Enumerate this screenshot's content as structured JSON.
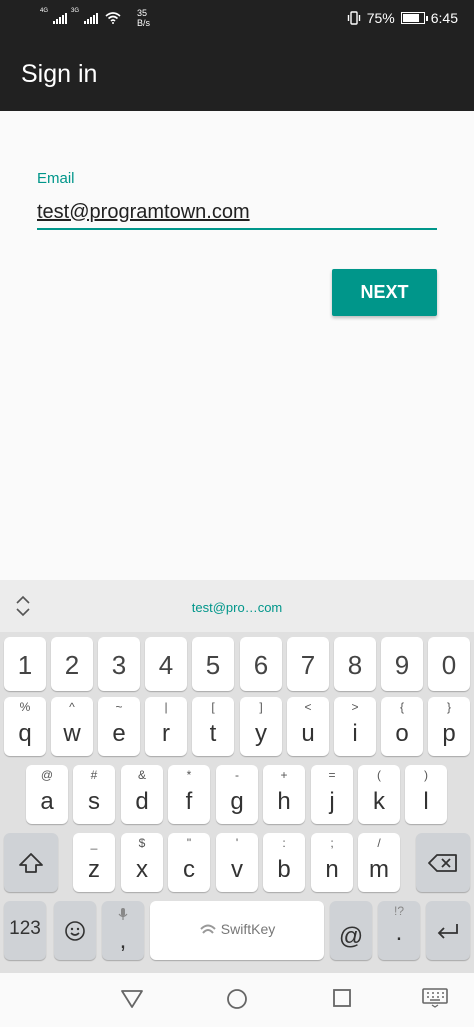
{
  "status_bar": {
    "network_1": "4G",
    "network_2": "3G",
    "speed_value": "35",
    "speed_unit": "B/s",
    "battery": "75%",
    "time": "6:45"
  },
  "app_bar": {
    "title": "Sign in"
  },
  "form": {
    "email_label": "Email",
    "email_value": "test@programtown.com",
    "next_label": "NEXT"
  },
  "keyboard": {
    "suggestion": "test@pro…com",
    "number_row": [
      "1",
      "2",
      "3",
      "4",
      "5",
      "6",
      "7",
      "8",
      "9",
      "0"
    ],
    "row1": [
      {
        "main": "q",
        "sub": "%"
      },
      {
        "main": "w",
        "sub": "^"
      },
      {
        "main": "e",
        "sub": "~"
      },
      {
        "main": "r",
        "sub": "|"
      },
      {
        "main": "t",
        "sub": "["
      },
      {
        "main": "y",
        "sub": "]"
      },
      {
        "main": "u",
        "sub": "<"
      },
      {
        "main": "i",
        "sub": ">"
      },
      {
        "main": "o",
        "sub": "{"
      },
      {
        "main": "p",
        "sub": "}"
      }
    ],
    "row2": [
      {
        "main": "a",
        "sub": "@"
      },
      {
        "main": "s",
        "sub": "#"
      },
      {
        "main": "d",
        "sub": "&"
      },
      {
        "main": "f",
        "sub": "*"
      },
      {
        "main": "g",
        "sub": "-"
      },
      {
        "main": "h",
        "sub": "+"
      },
      {
        "main": "j",
        "sub": "="
      },
      {
        "main": "k",
        "sub": "("
      },
      {
        "main": "l",
        "sub": ")"
      }
    ],
    "row3": [
      {
        "main": "z",
        "sub": "_"
      },
      {
        "main": "x",
        "sub": "$"
      },
      {
        "main": "c",
        "sub": "\""
      },
      {
        "main": "v",
        "sub": "'"
      },
      {
        "main": "b",
        "sub": ":"
      },
      {
        "main": "n",
        "sub": ";"
      },
      {
        "main": "m",
        "sub": "/"
      }
    ],
    "symbols_label": "123",
    "comma": ",",
    "space_brand": "SwiftKey",
    "at": "@",
    "period": ".",
    "period_sub": "!?"
  },
  "colors": {
    "accent": "#00968a",
    "app_bar": "#212121",
    "keyboard_bg": "#e0e0e0"
  }
}
